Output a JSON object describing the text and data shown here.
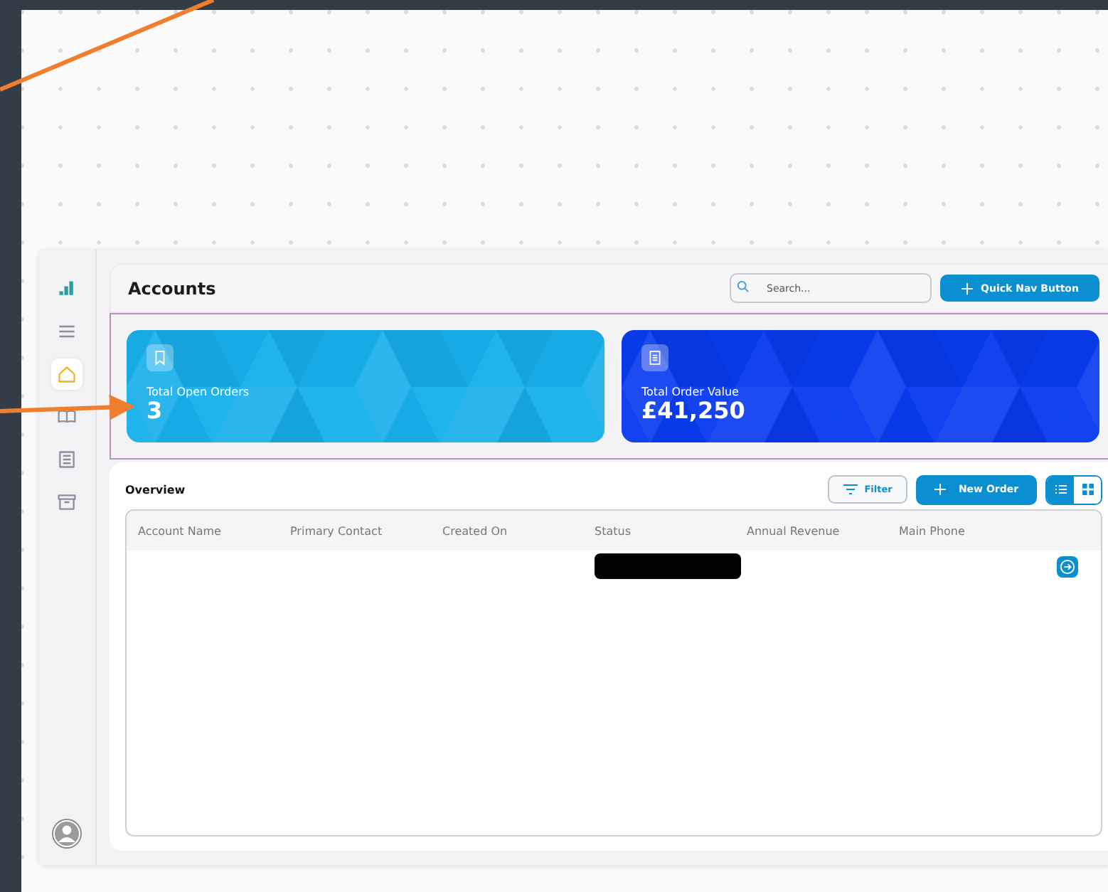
{
  "sidebar": {
    "items": [
      {
        "kind": "logo",
        "selected": false
      },
      {
        "kind": "menu",
        "selected": false
      },
      {
        "kind": "home",
        "selected": true
      },
      {
        "kind": "book",
        "selected": false
      },
      {
        "kind": "document",
        "selected": false
      },
      {
        "kind": "archive",
        "selected": false
      }
    ]
  },
  "header": {
    "title": "Accounts",
    "search": {
      "placeholder": "Search..."
    },
    "button": "Quick Nav Button"
  },
  "stats": [
    {
      "label": "Total Open Orders",
      "value": "3",
      "color": "#18b0ec"
    },
    {
      "label": "Total Order Value",
      "value": "£41,250",
      "color": "#0a3cf0"
    }
  ],
  "overview": {
    "title": "Overview",
    "filter": "Filter",
    "new_order": "New Order",
    "views": [
      {
        "kind": "list",
        "selected": true
      },
      {
        "kind": "grid",
        "selected": false
      }
    ]
  },
  "table": {
    "columns": [
      "Account Name",
      "Primary Contact",
      "Created On",
      "Status",
      "Annual Revenue",
      "Main Phone"
    ],
    "rows": [
      {
        "status_redacted": true
      }
    ]
  }
}
